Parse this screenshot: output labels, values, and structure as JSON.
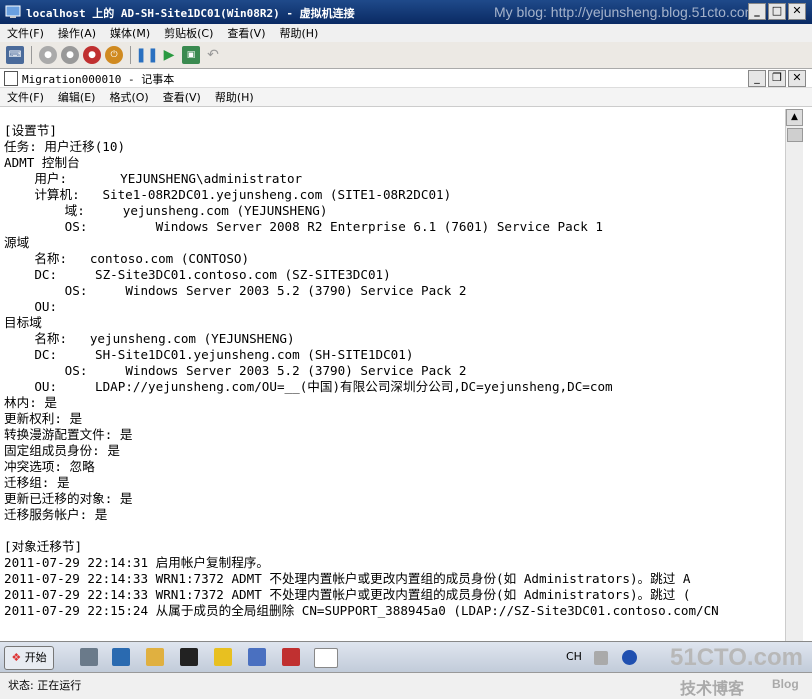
{
  "vm_window": {
    "title": "localhost 上的 AD-SH-Site1DC01(Win08R2) - 虚拟机连接",
    "watermark": "My blog: http://yejunsheng.blog.51cto.com",
    "menu": [
      "文件(F)",
      "操作(A)",
      "媒体(M)",
      "剪贴板(C)",
      "查看(V)",
      "帮助(H)"
    ]
  },
  "notepad": {
    "title": "Migration000010 - 记事本",
    "menu": [
      "文件(F)",
      "编辑(E)",
      "格式(O)",
      "查看(V)",
      "帮助(H)"
    ],
    "lines": [
      "[设置节]",
      "任务: 用户迁移(10)",
      "ADMT 控制台",
      "    用户:       YEJUNSHENG\\administrator",
      "    计算机:   Site1-08R2DC01.yejunsheng.com (SITE1-08R2DC01)",
      "        域:     yejunsheng.com (YEJUNSHENG)",
      "        OS:         Windows Server 2008 R2 Enterprise 6.1 (7601) Service Pack 1",
      "源域",
      "    名称:   contoso.com (CONTOSO)",
      "    DC:     SZ-Site3DC01.contoso.com (SZ-SITE3DC01)",
      "        OS:     Windows Server 2003 5.2 (3790) Service Pack 2",
      "    OU:",
      "目标域",
      "    名称:   yejunsheng.com (YEJUNSHENG)",
      "    DC:     SH-Site1DC01.yejunsheng.com (SH-SITE1DC01)",
      "        OS:     Windows Server 2003 5.2 (3790) Service Pack 2",
      "    OU:     LDAP://yejunsheng.com/OU=__(中国)有限公司深圳分公司,DC=yejunsheng,DC=com",
      "林内: 是",
      "更新权利: 是",
      "转换漫游配置文件: 是",
      "固定组成员身份: 是",
      "冲突选项: 忽略",
      "迁移组: 是",
      "更新已迁移的对象: 是",
      "迁移服务帐户: 是",
      "",
      "[对象迁移节]",
      "2011-07-29 22:14:31 启用帐户复制程序。",
      "2011-07-29 22:14:33 WRN1:7372 ADMT 不处理内置帐户或更改内置组的成员身份(如 Administrators)。跳过 A",
      "2011-07-29 22:14:33 WRN1:7372 ADMT 不处理内置帐户或更改内置组的成员身份(如 Administrators)。跳过 (",
      "2011-07-29 22:15:24 从属于成员的全局组删除 CN=SUPPORT_388945a0 (LDAP://SZ-Site3DC01.contoso.com/CN"
    ]
  },
  "taskbar": {
    "start_label": "开始",
    "language": "CH"
  },
  "status": {
    "text": "状态: 正在运行"
  },
  "watermarks": {
    "site": "51CTO.com",
    "sub": "技术博客",
    "blog": "Blog"
  }
}
